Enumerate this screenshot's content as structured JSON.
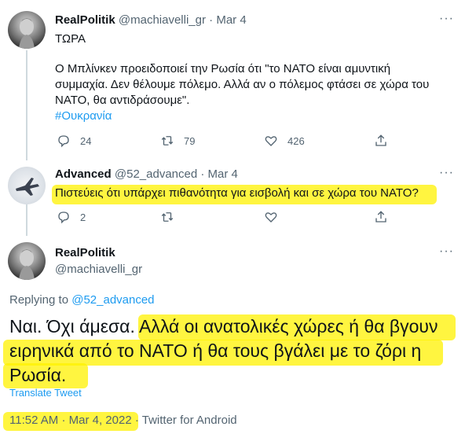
{
  "tweet1": {
    "name": "RealPolitik",
    "handle": "@machiavelli_gr",
    "date": "Mar 4",
    "line0": "ΤΩΡΑ",
    "line1": "Ο Μπλίνκεν προειδοποιεί την Ρωσία ότι \"το ΝΑΤΟ είναι αμυντική",
    "line2": "συμμαχία. Δεν θέλουμε πόλεμο. Αλλά αν ο πόλεμος φτάσει σε χώρα του",
    "line3": "ΝΑΤΟ, θα αντιδράσουμε\".",
    "hashtag": "#Ουκρανία",
    "replies": "24",
    "retweets": "79",
    "likes": "426"
  },
  "tweet2": {
    "name": "Advanced",
    "handle": "@52_advanced",
    "date": "Mar 4",
    "text": "Πιστεύεις ότι υπάρχει πιθανότητα για εισβολή και σε χώρα του ΝΑΤΟ?",
    "replies": "2"
  },
  "tweet3": {
    "name": "RealPolitik",
    "handle": "@machiavelli_gr",
    "replying_prefix": "Replying to",
    "replying_to": "@52_advanced",
    "line1": "Ναι. Όχι άμεσα. Αλλά οι ανατολικές χώρες ή θα βγουν",
    "line2": "ειρηνικά από το ΝΑΤΟ ή θα τους βγάλει με το ζόρι η",
    "line3": "Ρωσία.",
    "translate": "Translate Tweet",
    "time": "11:52 AM",
    "full_date": "Mar 4, 2022",
    "source": "Twitter for Android"
  },
  "common": {
    "dot": "·",
    "more": "···"
  },
  "icons": [
    "reply-icon",
    "retweet-icon",
    "like-icon",
    "share-icon",
    "more-icon"
  ]
}
